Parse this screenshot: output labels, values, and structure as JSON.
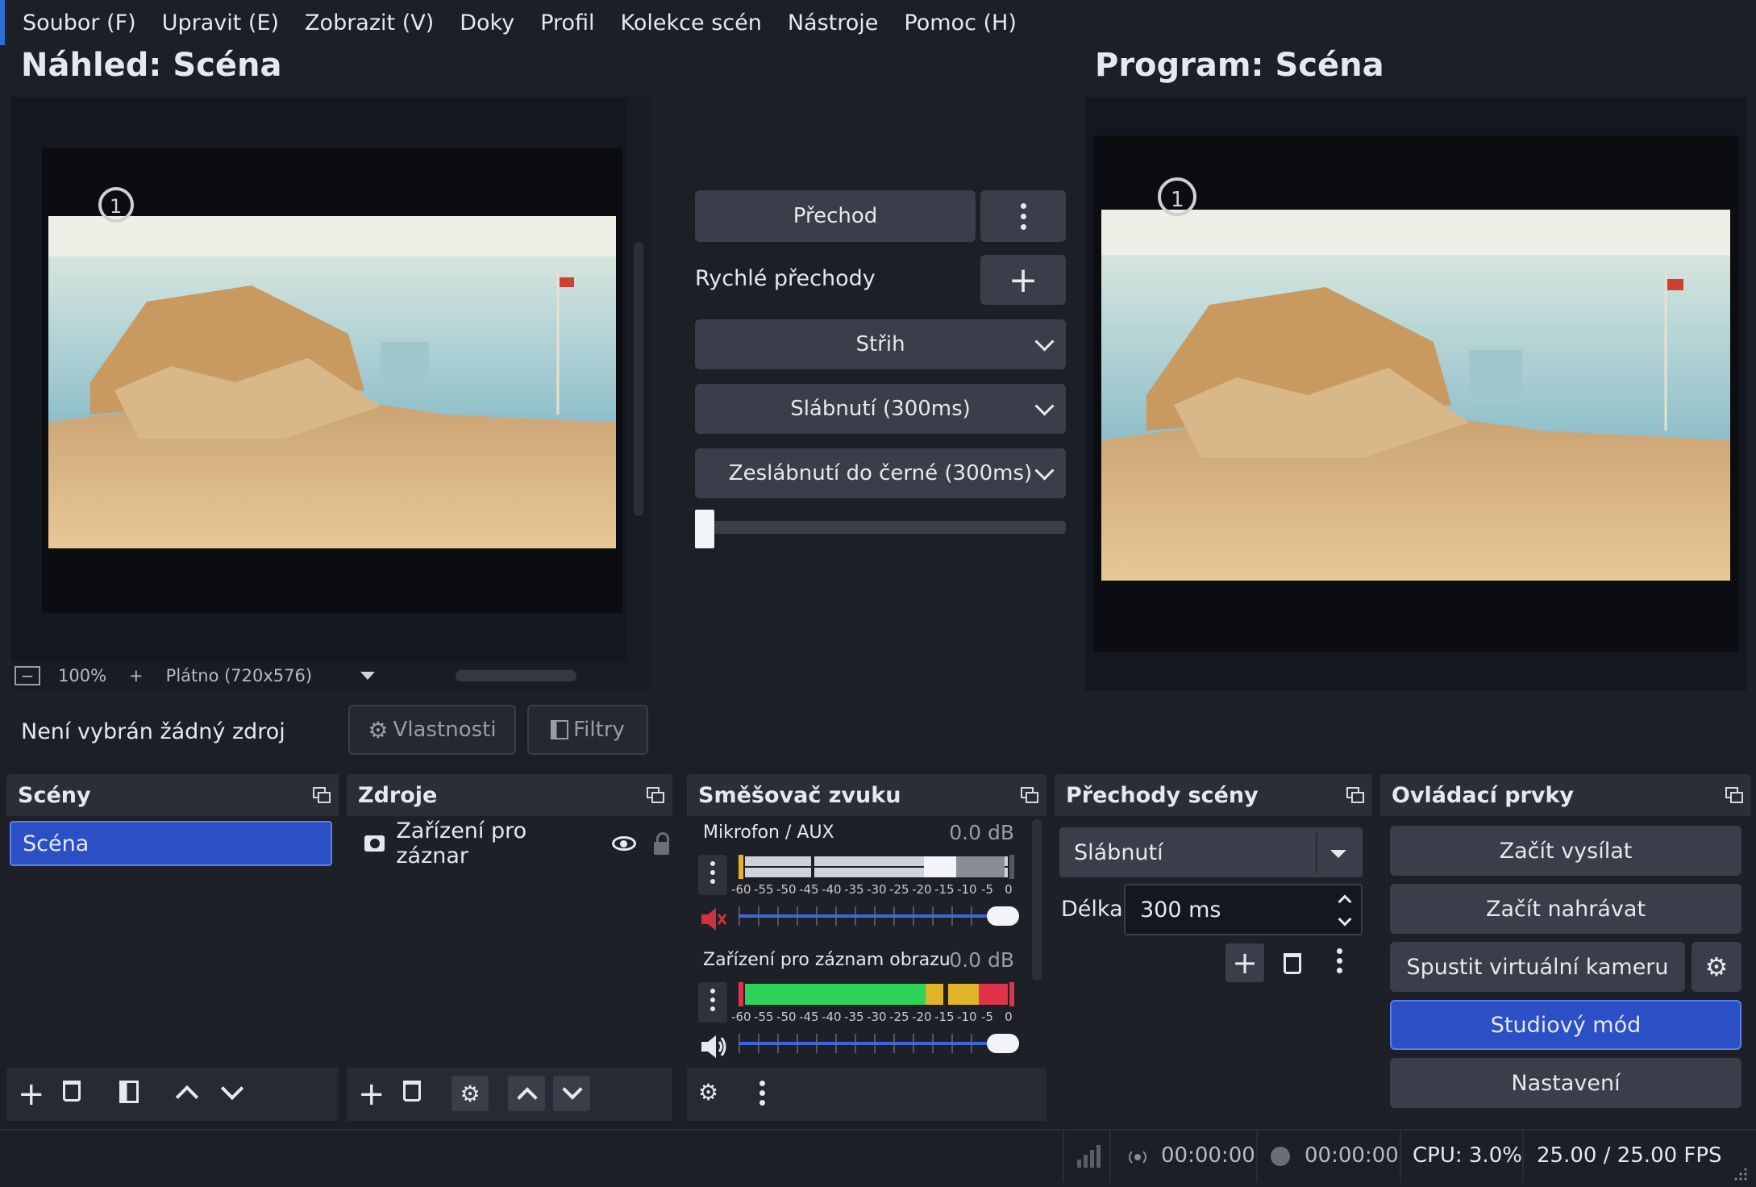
{
  "menu": [
    "Soubor (F)",
    "Upravit (E)",
    "Zobrazit (V)",
    "Doky",
    "Profil",
    "Kolekce scén",
    "Nástroje",
    "Pomoc (H)"
  ],
  "preview": {
    "title": "Náhled: Scéna",
    "zoom": "100%",
    "canvas": "Plátno (720x576)",
    "minus": "−",
    "plus": "+"
  },
  "program": {
    "title": "Program: Scéna"
  },
  "transition": {
    "button": "Přechod",
    "quick_label": "Rychlé přechody",
    "options": [
      "Střih",
      "Slábnutí (300ms)",
      "Zeslábnutí do černé (300ms)"
    ],
    "tbar_value": 0.0
  },
  "source_bar": {
    "no_source": "Není vybrán žádný zdroj",
    "properties": "Vlastnosti",
    "filters": "Filtry"
  },
  "scenes": {
    "title": "Scény",
    "items": [
      "Scéna"
    ]
  },
  "sources": {
    "title": "Zdroje",
    "items": [
      "Zařízení pro záznar"
    ]
  },
  "mixer": {
    "title": "Směšovač zvuku",
    "scale": [
      "-60",
      "-55",
      "-50",
      "-45",
      "-40",
      "-35",
      "-30",
      "-25",
      "-20",
      "-15",
      "-10",
      "-5",
      "0"
    ],
    "channels": [
      {
        "name": "Mikrofon / AUX",
        "db": "0.0 dB",
        "muted": true,
        "volume": 1.0
      },
      {
        "name": "Zařízení pro záznam obrazu",
        "db": "0.0 dB",
        "muted": false,
        "volume": 1.0
      }
    ]
  },
  "transitions_dock": {
    "title": "Přechody scény",
    "selected": "Slábnutí",
    "duration_label": "Délka",
    "duration": "300 ms"
  },
  "controls": {
    "title": "Ovládací prvky",
    "stream": "Začít vysílat",
    "record": "Začít nahrávat",
    "virtualcam": "Spustit virtuální kameru",
    "studio": "Studiový mód",
    "settings": "Nastavení"
  },
  "status": {
    "rec_time": "00:00:00",
    "stream_time": "00:00:00",
    "cpu": "CPU: 3.0%",
    "fps": "25.00 / 25.00 FPS"
  },
  "colors": {
    "accent": "#2b4fc4",
    "meter_green": "#2fd35a",
    "meter_yellow": "#e0b429",
    "meter_red": "#e0334a",
    "mute_red": "#d03040"
  }
}
